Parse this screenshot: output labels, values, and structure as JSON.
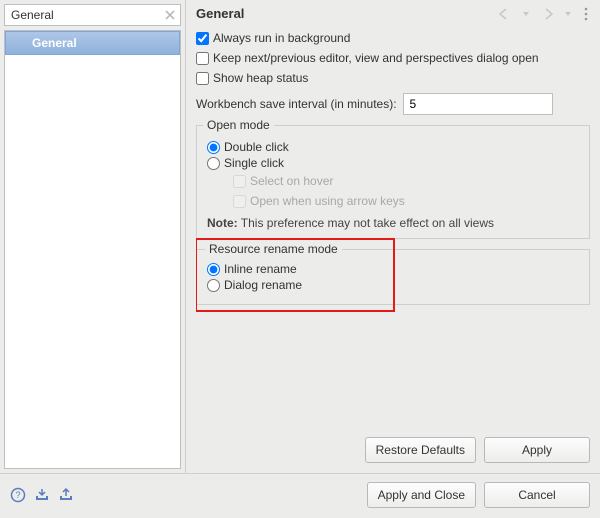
{
  "sidebar": {
    "search_value": "General",
    "items": [
      "General"
    ]
  },
  "page": {
    "title": "General"
  },
  "settings": {
    "always_bg_label": "Always run in background",
    "always_bg_checked": true,
    "keep_dialog_label": "Keep next/previous editor, view and perspectives dialog open",
    "keep_dialog_checked": false,
    "heap_label": "Show heap status",
    "heap_checked": false,
    "interval_label": "Workbench save interval (in minutes):",
    "interval_value": "5"
  },
  "open_mode": {
    "legend": "Open mode",
    "double_label": "Double click",
    "single_label": "Single click",
    "selected": "double",
    "select_hover_label": "Select on hover",
    "arrow_keys_label": "Open when using arrow keys",
    "note_prefix": "Note:",
    "note_text": " This preference may not take effect on all views"
  },
  "rename_mode": {
    "legend": "Resource rename mode",
    "inline_label": "Inline rename",
    "dialog_label": "Dialog rename",
    "selected": "inline"
  },
  "buttons": {
    "restore": "Restore Defaults",
    "apply": "Apply",
    "apply_close": "Apply and Close",
    "cancel": "Cancel"
  }
}
